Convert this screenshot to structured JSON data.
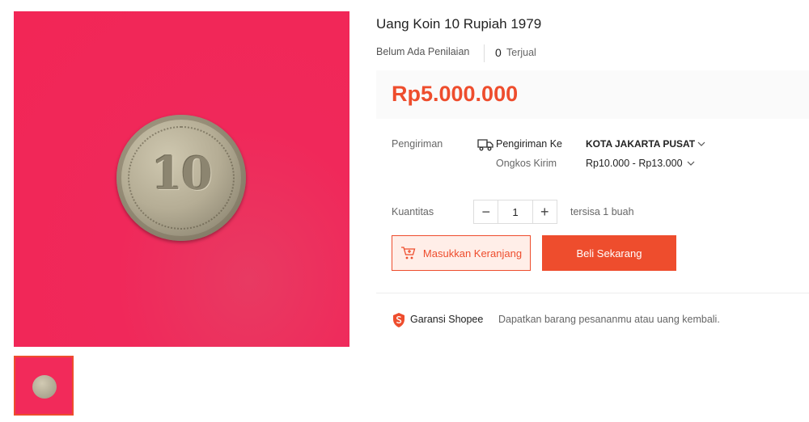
{
  "product": {
    "title": "Uang Koin 10 Rupiah 1979",
    "rating_text": "Belum Ada Penilaian",
    "sold_count": "0",
    "sold_label": "Terjual",
    "price": "Rp5.000.000"
  },
  "shipping": {
    "label": "Pengiriman",
    "to_label": "Pengiriman Ke",
    "destination": "KOTA JAKARTA PUSAT",
    "cost_label": "Ongkos Kirim",
    "cost_range": "Rp10.000 - Rp13.000"
  },
  "quantity": {
    "label": "Kuantitas",
    "minus": "−",
    "value": "1",
    "plus": "+",
    "stock_text": "tersisa 1 buah"
  },
  "actions": {
    "add_to_cart": "Masukkan Keranjang",
    "buy_now": "Beli Sekarang"
  },
  "guarantee": {
    "title": "Garansi Shopee",
    "text": "Dapatkan barang pesananmu atau uang kembali."
  },
  "colors": {
    "accent": "#ee4d2d",
    "image_bg": "#f22656"
  },
  "icons": {
    "truck": "truck-icon",
    "cart": "cart-plus-icon",
    "shield": "shield-icon",
    "chevron": "chevron-down-icon"
  }
}
